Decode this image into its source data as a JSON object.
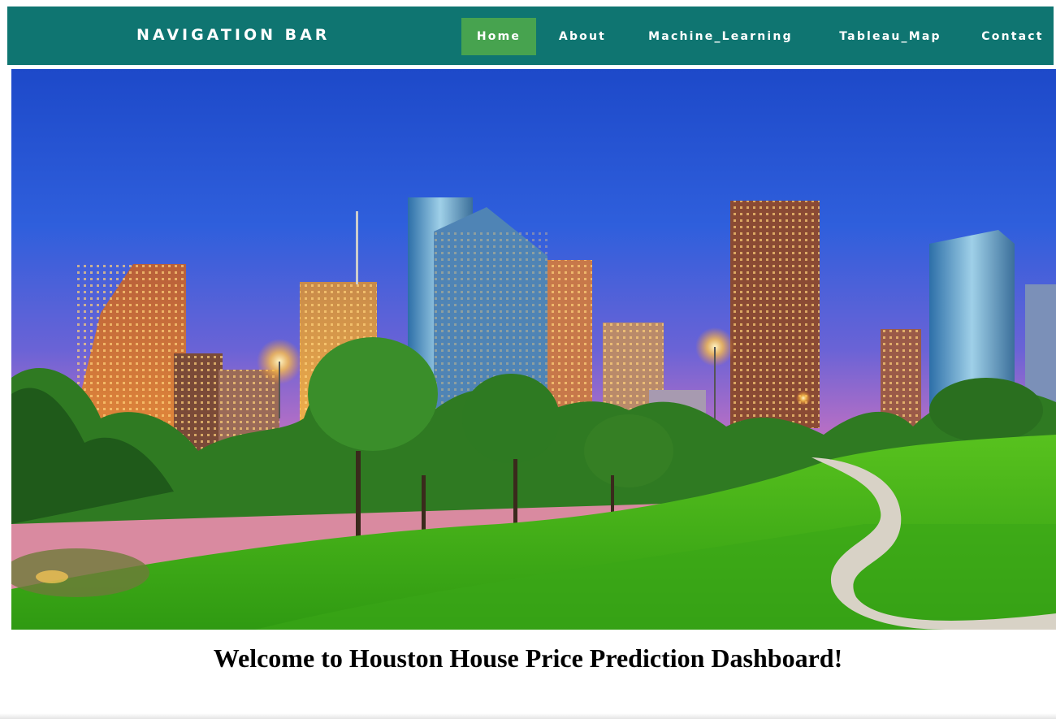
{
  "navbar": {
    "brand": "NAVIGATION BAR",
    "items": [
      {
        "label": "Home",
        "active": true
      },
      {
        "label": "About",
        "active": false
      },
      {
        "label": "Machine_Learning",
        "active": false
      },
      {
        "label": "Tableau_Map",
        "active": false
      },
      {
        "label": "Contact",
        "active": false
      }
    ],
    "colors": {
      "bar": "#0f7571",
      "active": "#47a34f",
      "text": "#ffffff"
    }
  },
  "hero": {
    "image": "houston-skyline-park-photo"
  },
  "main": {
    "welcome": "Welcome to Houston House Price Prediction Dashboard!"
  }
}
